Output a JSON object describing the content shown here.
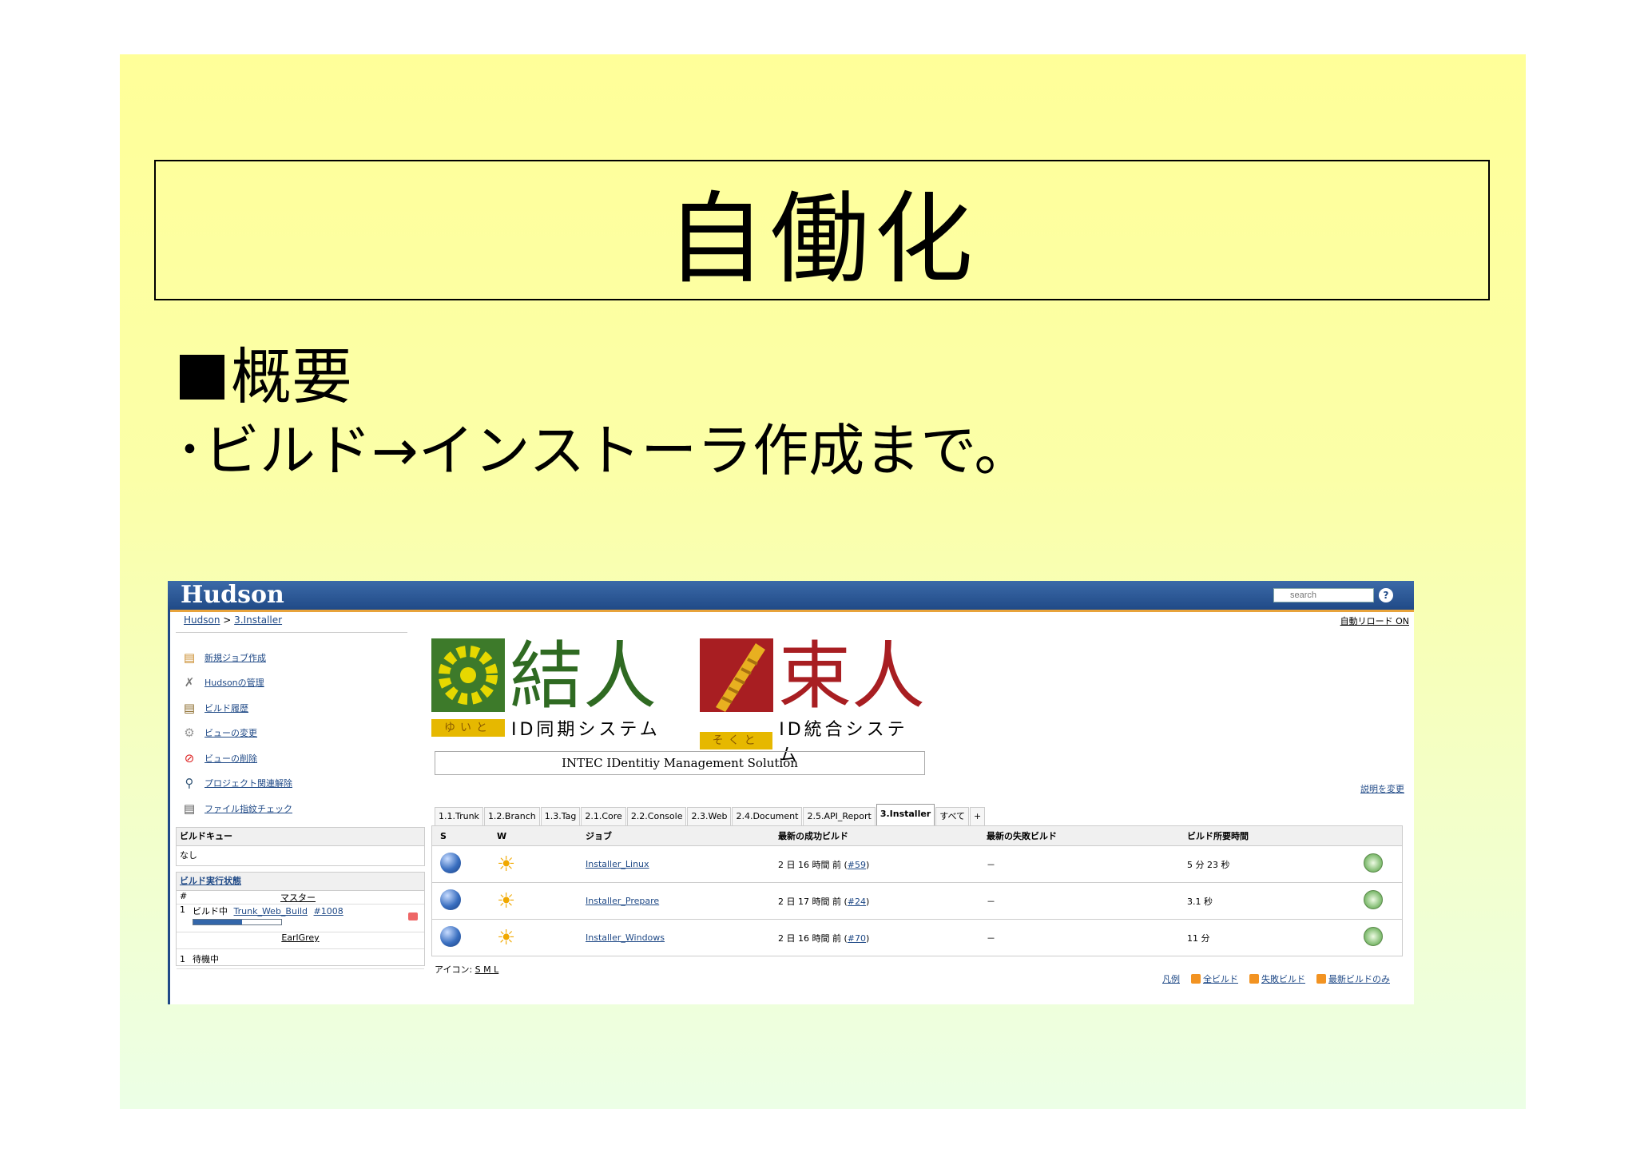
{
  "slide": {
    "title": "自働化",
    "heading": "概要",
    "bullet": "･ビルド→インストーラ作成まで。"
  },
  "hudson": {
    "logo": "Hudson",
    "search_placeholder": "search",
    "help": "?",
    "breadcrumb": [
      "Hudson",
      "3.Installer"
    ],
    "breadcrumb_sep": ">",
    "auto_refresh": "自動リロード ON",
    "tasks": [
      {
        "icon": "new-job-icon",
        "label": "新規ジョブ作成"
      },
      {
        "icon": "manage-hudson-icon",
        "label": "Hudsonの管理"
      },
      {
        "icon": "build-history-icon",
        "label": "ビルド履歴"
      },
      {
        "icon": "edit-view-icon",
        "label": "ビューの変更"
      },
      {
        "icon": "delete-view-icon",
        "label": "ビューの削除"
      },
      {
        "icon": "search-icon",
        "label": "プロジェクト関連解除"
      },
      {
        "icon": "fingerprint-icon",
        "label": "ファイル指紋チェック"
      }
    ],
    "build_queue": {
      "title": "ビルドキュー",
      "empty": "なし"
    },
    "executors": {
      "title": "ビルド実行状態",
      "col_num": "#",
      "master": "マスター",
      "row1_num": "1",
      "row1_label": "ビルド中",
      "row1_job": "Trunk_Web_Build",
      "row1_build": "#1008",
      "progress": 0.55,
      "node": "EarlGrey",
      "row2_num": "1",
      "row2_label": "待機中"
    },
    "logo1": {
      "kanji": "結人",
      "tag": "ゆいと",
      "sub": "ID同期システム"
    },
    "logo2": {
      "kanji": "束人",
      "tag": "そくと",
      "sub": "ID統合システム"
    },
    "intec": "INTEC IDentitiy Management Solution",
    "edit_description": "説明を変更",
    "tabs": [
      "1.1.Trunk",
      "1.2.Branch",
      "1.3.Tag",
      "2.1.Core",
      "2.2.Console",
      "2.3.Web",
      "2.4.Document",
      "2.5.API_Report",
      "3.Installer",
      "すべて",
      "+"
    ],
    "active_tab": "3.Installer",
    "table": {
      "headers": [
        "S",
        "W",
        "ジョブ",
        "最新の成功ビルド",
        "最新の失敗ビルド",
        "ビルド所要時間"
      ],
      "rows": [
        {
          "job": "Installer_Linux",
          "last_success": "2 日 16 時間 前",
          "success_build": "#59",
          "last_fail": "－",
          "duration": "5 分 23 秒"
        },
        {
          "job": "Installer_Prepare",
          "last_success": "2 日 17 時間 前",
          "success_build": "#24",
          "last_fail": "－",
          "duration": "3.1 秒"
        },
        {
          "job": "Installer_Windows",
          "last_success": "2 日 16 時間 前",
          "success_build": "#70",
          "last_fail": "－",
          "duration": "11 分"
        }
      ]
    },
    "icon_legend_label": "アイコン:",
    "icon_sizes": "S M L",
    "feeds": [
      "凡例",
      "全ビルド",
      "失敗ビルド",
      "最新ビルドのみ"
    ]
  }
}
